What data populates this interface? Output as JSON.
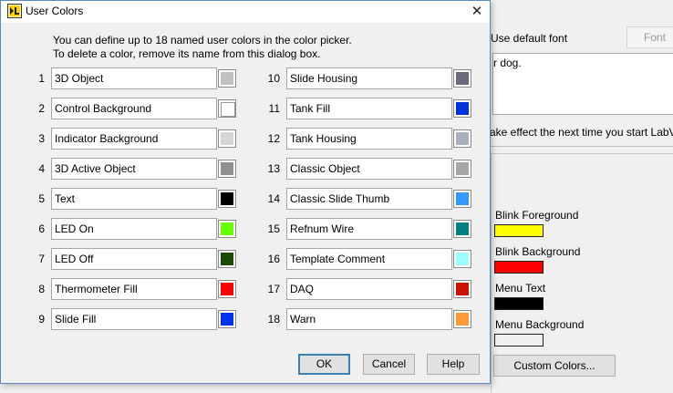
{
  "dialog": {
    "title": "User Colors",
    "intro_line1": "You can define up to 18 named user colors in the color picker.",
    "intro_line2": "To delete a color, remove its name from this dialog box.",
    "left_colors": [
      {
        "num": "1",
        "name": "3D Object",
        "color": "#c0c0c0"
      },
      {
        "num": "2",
        "name": "Control Background",
        "color": "#ffffff"
      },
      {
        "num": "3",
        "name": "Indicator Background",
        "color": "#d4d4d4"
      },
      {
        "num": "4",
        "name": "3D Active Object",
        "color": "#909090"
      },
      {
        "num": "5",
        "name": "Text",
        "color": "#000000"
      },
      {
        "num": "6",
        "name": "LED On",
        "color": "#66ff00"
      },
      {
        "num": "7",
        "name": "LED Off",
        "color": "#1a4a00"
      },
      {
        "num": "8",
        "name": "Thermometer Fill",
        "color": "#ff0000"
      },
      {
        "num": "9",
        "name": "Slide Fill",
        "color": "#0033ee"
      }
    ],
    "right_colors": [
      {
        "num": "10",
        "name": "Slide Housing",
        "color": "#6a6a7a"
      },
      {
        "num": "11",
        "name": "Tank Fill",
        "color": "#0033dd"
      },
      {
        "num": "12",
        "name": "Tank Housing",
        "color": "#a8b0c0"
      },
      {
        "num": "13",
        "name": "Classic Object",
        "color": "#a6a6a6"
      },
      {
        "num": "14",
        "name": "Classic Slide Thumb",
        "color": "#3399ff"
      },
      {
        "num": "15",
        "name": "Refnum Wire",
        "color": "#008080"
      },
      {
        "num": "16",
        "name": "Template Comment",
        "color": "#99ffff"
      },
      {
        "num": "17",
        "name": "DAQ",
        "color": "#cc1100"
      },
      {
        "num": "18",
        "name": "Warn",
        "color": "#ff9933"
      }
    ],
    "buttons": {
      "ok": "OK",
      "cancel": "Cancel",
      "help": "Help"
    }
  },
  "background": {
    "use_default_font": "Use default font",
    "font_button": "Font",
    "sample_text": "r dog.",
    "take_effect": "ake effect the next time you start LabVIEW.",
    "swatches": [
      {
        "label": "Blink Foreground",
        "color": "#ffff00"
      },
      {
        "label": "Blink Background",
        "color": "#ff0000"
      },
      {
        "label": "Menu Text",
        "color": "#000000"
      },
      {
        "label": "Menu Background",
        "color": "#f0f0f0"
      }
    ],
    "custom_colors_button": "Custom Colors..."
  }
}
